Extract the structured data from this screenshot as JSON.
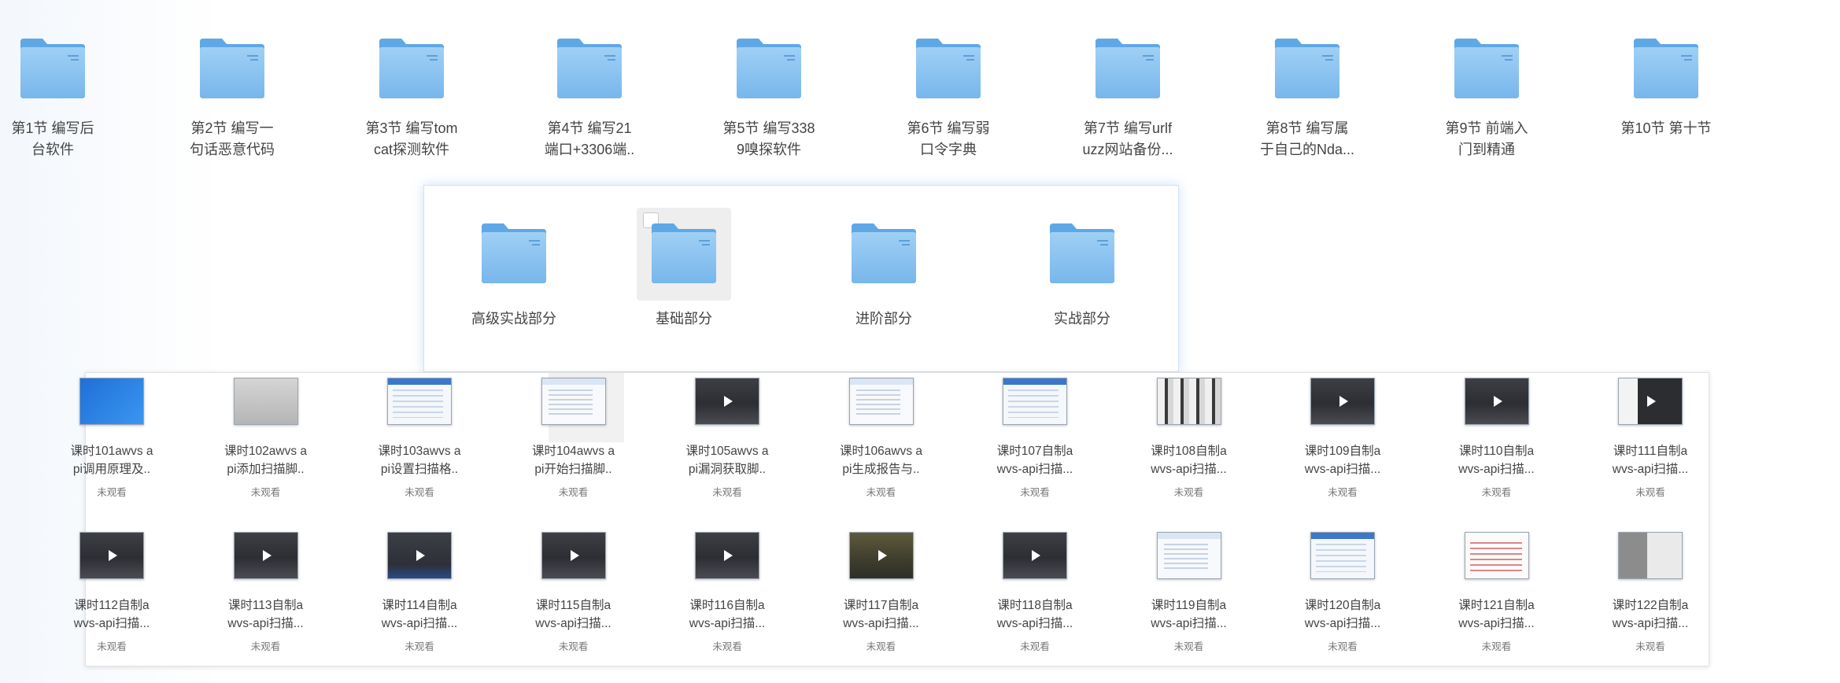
{
  "top_folders": [
    {
      "label": "第1节 编写后\n台软件"
    },
    {
      "label": "第2节 编写一\n句话恶意代码"
    },
    {
      "label": "第3节 编写tom\ncat探测软件"
    },
    {
      "label": "第4节 编写21\n端口+3306端.."
    },
    {
      "label": "第5节 编写338\n9嗅探软件"
    },
    {
      "label": "第6节 编写弱\n口令字典"
    },
    {
      "label": "第7节 编写urlf\nuzz网站备份..."
    },
    {
      "label": "第8节 编写属\n于自己的Nda..."
    },
    {
      "label": "第9节 前端入\n门到精通"
    },
    {
      "label": "第10节 第十节"
    }
  ],
  "panel_folders": [
    {
      "label": "高级实战部分"
    },
    {
      "label": "基础部分"
    },
    {
      "label": "进阶部分"
    },
    {
      "label": "实战部分"
    }
  ],
  "videos": [
    {
      "title": "课时101awvs a\npi调用原理及..",
      "status": "未观看",
      "thumb": "win",
      "play": false
    },
    {
      "title": "课时102awvs a\npi添加扫描脚..",
      "status": "未观看",
      "thumb": "gray",
      "play": false
    },
    {
      "title": "课时103awvs a\npi设置扫描格..",
      "status": "未观看",
      "thumb": "webblue",
      "play": false
    },
    {
      "title": "课时104awvs a\npi开始扫描脚..",
      "status": "未观看",
      "thumb": "web",
      "play": false
    },
    {
      "title": "课时105awvs a\npi漏洞获取脚..",
      "status": "未观看",
      "thumb": "dark",
      "play": true
    },
    {
      "title": "课时106awvs a\npi生成报告与..",
      "status": "未观看",
      "thumb": "web",
      "play": false
    },
    {
      "title": "课时107自制a\nwvs-api扫描...",
      "status": "未观看",
      "thumb": "webblue",
      "play": false
    },
    {
      "title": "课时108自制a\nwvs-api扫描...",
      "status": "未观看",
      "thumb": "collage",
      "play": false
    },
    {
      "title": "课时109自制a\nwvs-api扫描...",
      "status": "未观看",
      "thumb": "dark",
      "play": true
    },
    {
      "title": "课时110自制a\nwvs-api扫描...",
      "status": "未观看",
      "thumb": "dark",
      "play": true
    },
    {
      "title": "课时111自制a\nwvs-api扫描...",
      "status": "未观看",
      "thumb": "darkweb",
      "play": true
    },
    {
      "title": "课时112自制a\nwvs-api扫描...",
      "status": "未观看",
      "thumb": "dark",
      "play": true
    },
    {
      "title": "课时113自制a\nwvs-api扫描...",
      "status": "未观看",
      "thumb": "dark",
      "play": true
    },
    {
      "title": "课时114自制a\nwvs-api扫描...",
      "status": "未观看",
      "thumb": "dark-blue",
      "play": true
    },
    {
      "title": "课时115自制a\nwvs-api扫描...",
      "status": "未观看",
      "thumb": "dark",
      "play": true
    },
    {
      "title": "课时116自制a\nwvs-api扫描...",
      "status": "未观看",
      "thumb": "dark",
      "play": true
    },
    {
      "title": "课时117自制a\nwvs-api扫描...",
      "status": "未观看",
      "thumb": "dark-olive",
      "play": true
    },
    {
      "title": "课时118自制a\nwvs-api扫描...",
      "status": "未观看",
      "thumb": "dark",
      "play": true
    },
    {
      "title": "课时119自制a\nwvs-api扫描...",
      "status": "未观看",
      "thumb": "web",
      "play": false
    },
    {
      "title": "课时120自制a\nwvs-api扫描...",
      "status": "未观看",
      "thumb": "webblue",
      "play": false
    },
    {
      "title": "课时121自制a\nwvs-api扫描...",
      "status": "未观看",
      "thumb": "redweb",
      "play": false
    },
    {
      "title": "课时122自制a\nwvs-api扫描...",
      "status": "未观看",
      "thumb": "mixed",
      "play": false
    }
  ],
  "colors": {
    "folder_front": "#8cc3ef",
    "folder_back": "#5da7e6",
    "panel_border": "#cfe2f6"
  }
}
